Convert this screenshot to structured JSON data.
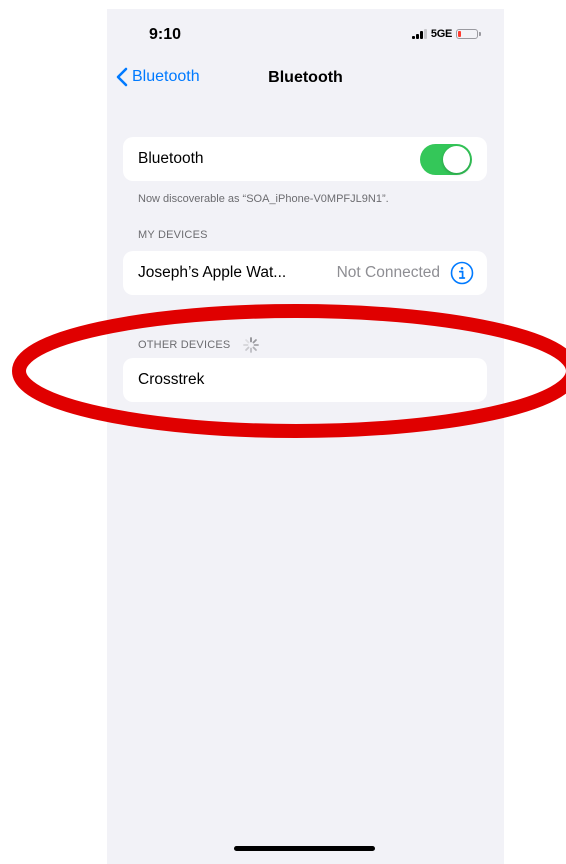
{
  "status_bar": {
    "time": "9:10",
    "network": "5GE",
    "battery_level": 0.15,
    "battery_color": "#ff3b30"
  },
  "nav": {
    "back_label": "Bluetooth",
    "back_icon": "chevron-left-icon",
    "title": "Bluetooth",
    "accent_color": "#007aff"
  },
  "bluetooth_toggle": {
    "label": "Bluetooth",
    "on": true,
    "color": "#34c759"
  },
  "discoverable_note": "Now discoverable as “SOA_iPhone-V0MPFJL9N1”.",
  "my_devices": {
    "header": "MY DEVICES",
    "items": [
      {
        "name": "Joseph’s Apple Wat...",
        "status": "Not Connected",
        "icon": "info-icon"
      }
    ]
  },
  "other_devices": {
    "header": "OTHER DEVICES",
    "loading_icon": "spinner-icon",
    "items": [
      {
        "name": "Crosstrek"
      }
    ]
  },
  "annotation": {
    "shape": "ellipse",
    "color": "#e00000"
  }
}
